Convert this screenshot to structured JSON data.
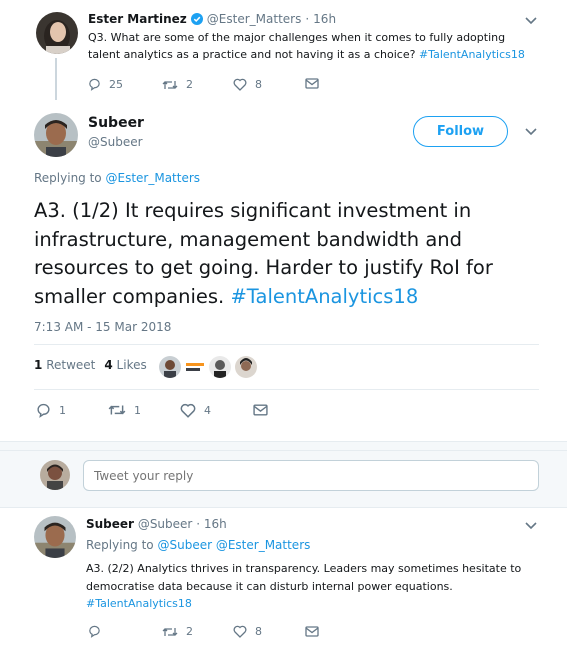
{
  "parent_tweet": {
    "author_name": "Ester Martinez",
    "author_handle": "@Ester_Matters",
    "time": "16h",
    "text_plain": "Q3. What are some of the major challenges when it comes to fully adopting talent analytics as a practice and not having it as a choice? ",
    "hashtag": "#TalentAnalytics18",
    "replies": "25",
    "retweets": "2",
    "likes": "8"
  },
  "main_tweet": {
    "author_name": "Subeer",
    "author_handle": "@Subeer",
    "follow_label": "Follow",
    "replying_to_label": "Replying to",
    "replying_to_handle": "@Ester_Matters",
    "text_plain": "A3. (1/2) It requires significant investment in infrastructure, management bandwidth and resources to get going. Harder to justify RoI for smaller companies. ",
    "hashtag": "#TalentAnalytics18",
    "timestamp": "7:13 AM - 15 Mar 2018",
    "retweet_count": "1",
    "retweet_label": "Retweet",
    "like_count": "4",
    "like_label": "Likes",
    "action_replies": "1",
    "action_retweets": "1",
    "action_likes": "4"
  },
  "reply_box": {
    "placeholder": "Tweet your reply"
  },
  "reply_tweet": {
    "author_name": "Subeer",
    "author_handle": "@Subeer",
    "time": "16h",
    "replying_to_label": "Replying to",
    "replying_to_handles": "@Subeer @Ester_Matters",
    "text_plain": "A3. (2/2) Analytics thrives in transparency. Leaders may sometimes hesitate to democratise data because it can disturb internal power equations.",
    "hashtag": "#TalentAnalytics18",
    "replies": "",
    "retweets": "2",
    "likes": "8"
  },
  "colors": {
    "link": "#1b95e0",
    "follow_border": "#1da1f2",
    "muted": "#657786",
    "thread_line": "#ccd6dd",
    "divider": "#e6ecf0"
  },
  "icons": [
    "reply-icon",
    "retweet-icon",
    "like-icon",
    "message-icon",
    "verified-icon",
    "chevron-down-icon"
  ]
}
